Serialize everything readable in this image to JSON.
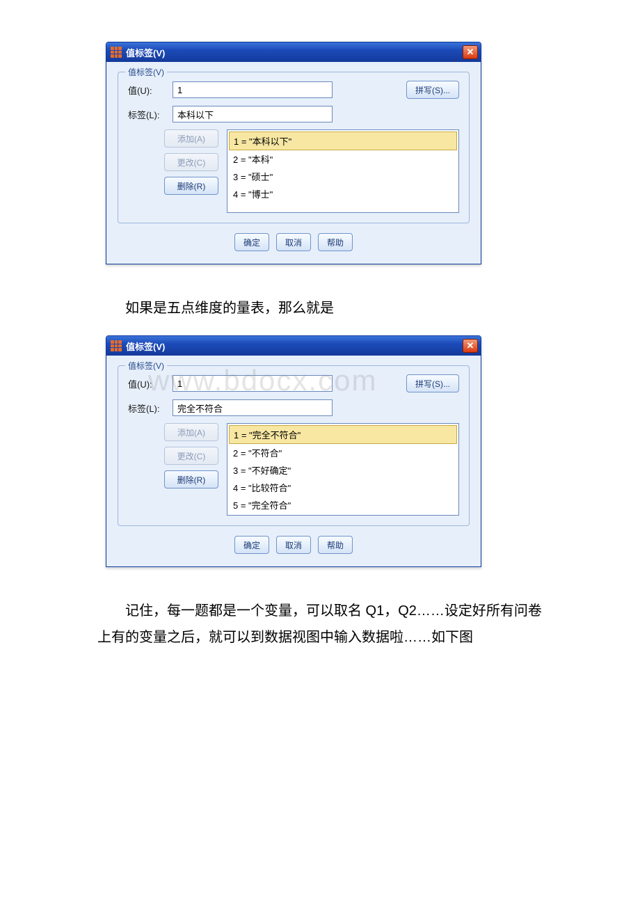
{
  "watermark": "www.bdocx.com",
  "dialog1": {
    "title": "值标签(V)",
    "group_legend": "值标签(V)",
    "value_label": "值(U):",
    "value_input": "1",
    "label_label": "标签(L):",
    "label_input": "本科以下",
    "spell_btn": "拼写(S)...",
    "btn_add": "添加(A)",
    "btn_change": "更改(C)",
    "btn_delete": "删除(R)",
    "items": [
      "1 = \"本科以下\"",
      "2 = \"本科\"",
      "3 = \"硕士\"",
      "4 = \"博士\""
    ],
    "selected_index": 0,
    "btn_ok": "确定",
    "btn_cancel": "取消",
    "btn_help": "帮助"
  },
  "text_between": "如果是五点维度的量表，那么就是",
  "dialog2": {
    "title": "值标签(V)",
    "group_legend": "值标签(V)",
    "value_label": "值(U):",
    "value_input": "1",
    "label_label": "标签(L):",
    "label_input": "完全不符合",
    "spell_btn": "拼写(S)...",
    "btn_add": "添加(A)",
    "btn_change": "更改(C)",
    "btn_delete": "删除(R)",
    "items": [
      "1 = \"完全不符合\"",
      "2 = \"不符合\"",
      "3 = \"不好确定\"",
      "4 = \"比较符合\"",
      "5 = \"完全符合\""
    ],
    "selected_index": 0,
    "btn_ok": "确定",
    "btn_cancel": "取消",
    "btn_help": "帮助"
  },
  "text_after": "记住，每一题都是一个变量，可以取名 Q1，Q2……设定好所有问卷上有的变量之后，就可以到数据视图中输入数据啦……如下图"
}
